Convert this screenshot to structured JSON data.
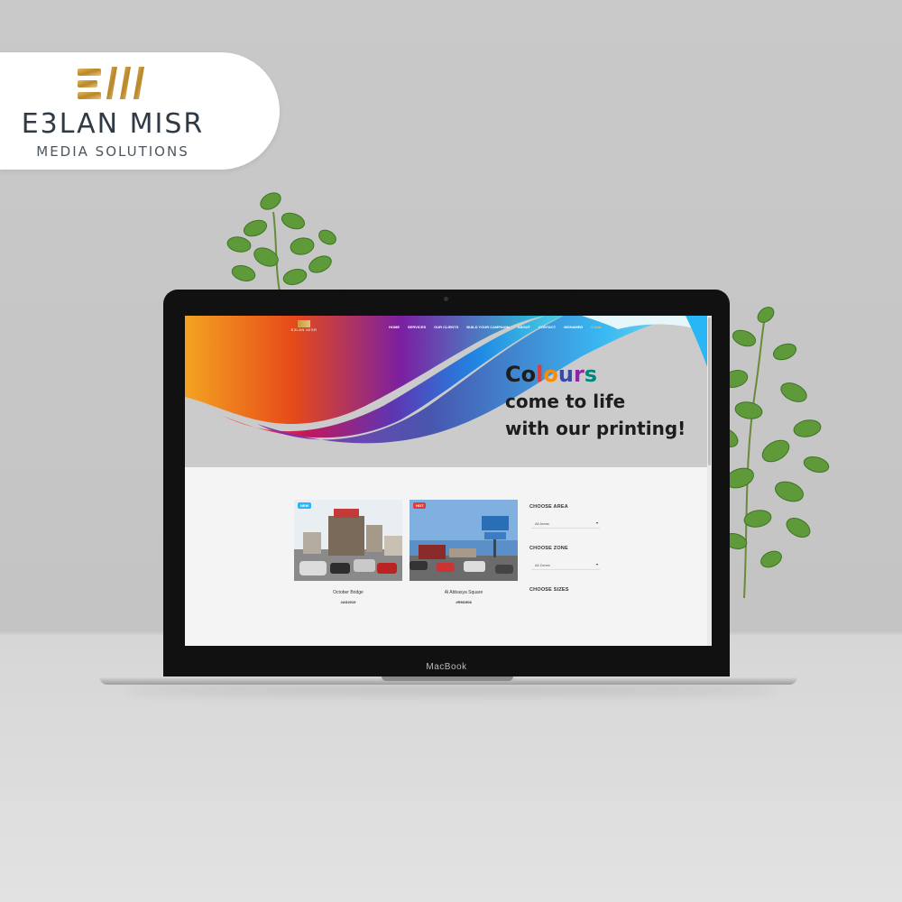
{
  "brand": {
    "name": "E3LAN MISR",
    "tagline": "MEDIA SOLUTIONS",
    "gold": "#c89a3c"
  },
  "laptop": {
    "label": "MacBook"
  },
  "site": {
    "logo_text": "E3LAN MISR",
    "nav": [
      "HOME",
      "SERVICES",
      "OUR CLIENTS",
      "BUILD YOUR CAMPAIGN",
      "ABOUT",
      "CONTACT",
      "MOHAMED",
      "0 Cart"
    ],
    "hero": {
      "line1": "Colours",
      "line2": "come to life",
      "line3": "with our printing!",
      "line1_colors": [
        "#1d1d1d",
        "#1d1d1d",
        "#e53935",
        "#fb8c00",
        "#3949ab",
        "#8e24aa",
        "#00897b"
      ]
    },
    "cards": [
      {
        "badge": "NEW",
        "badge_color": "#29b6f6",
        "title": "October Bridge",
        "code": "#AS2019"
      },
      {
        "badge": "HOT",
        "badge_color": "#e53935",
        "title": "Al Abbasya Square",
        "code": "#RM1508"
      }
    ],
    "filters": {
      "area_label": "CHOOSE AREA",
      "area_value": "All Areas",
      "zone_label": "CHOOSE ZONE",
      "zone_value": "All Zones",
      "sizes_label": "CHOOSE SIZES"
    }
  }
}
